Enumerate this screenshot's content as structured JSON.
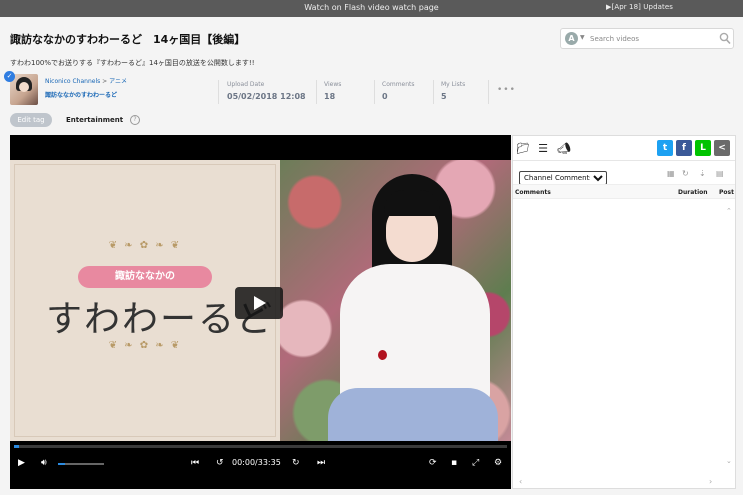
{
  "topbar": {
    "flash_link": "Watch on Flash video watch page",
    "updates_link": "▶[Apr 18] Updates"
  },
  "video": {
    "title": "諏訪ななかのすわわーるど　14ヶ国目【後編】",
    "description": "すわわ100%でお送りする『すわわーるど』14ヶ国目の放送を公開数します!!",
    "channel_breadcrumb": "Niconico Channels",
    "channel_category": "アニメ",
    "channel_name": "諏訪ななかのすわわーるど",
    "stats": {
      "upload_label": "Upload Date",
      "upload_value": "05/02/2018 12:08",
      "views_label": "Views",
      "views_value": "18",
      "comments_label": "Comments",
      "comments_value": "0",
      "mylists_label": "My Lists",
      "mylists_value": "5"
    },
    "more": "•••",
    "edit_tag": "Edit tag",
    "tag": "Entertainment"
  },
  "search": {
    "placeholder": "Search videos",
    "badge": "A"
  },
  "thumbnail": {
    "ribbon_text": "諏訪ななかの",
    "logo_text": "すわわーるど"
  },
  "player": {
    "time": "00:00/33:35",
    "seek_progress": 0.01,
    "volume_level": 0.15
  },
  "panel": {
    "comment_filter_options": [
      "Channel Comments"
    ],
    "col_comments": "Comments",
    "col_duration": "Duration",
    "col_post": "Post"
  },
  "colors": {
    "accent_blue": "#2c8be0",
    "link_blue": "#1766b5",
    "twitter": "#1da1f2",
    "facebook": "#3b5998",
    "line": "#00c300",
    "share": "#6b6b6b"
  }
}
